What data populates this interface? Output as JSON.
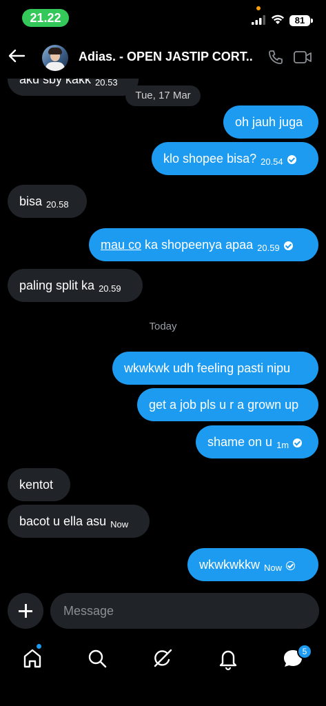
{
  "status_bar": {
    "time": "21.22",
    "battery": "81"
  },
  "header": {
    "title": "Adias. - OPEN JASTIP CORT..."
  },
  "messages": [
    {
      "dir": "in",
      "text": "aku sby kakk",
      "time": "20.53"
    },
    {
      "dir": "out",
      "text": "oh jauh juga"
    },
    {
      "dir": "out",
      "text": "klo shopee bisa?",
      "time": "20.54",
      "status": "read"
    },
    {
      "dir": "in",
      "text": "bisa",
      "time": "20.58"
    },
    {
      "dir": "out",
      "text_link": "mau co",
      "text": " ka shopeenya apaa",
      "time": "20.59",
      "status": "read"
    },
    {
      "dir": "in",
      "text": "paling split ka",
      "time": "20.59"
    },
    {
      "dir": "out",
      "text": "wkwkwk udh feeling pasti nipu"
    },
    {
      "dir": "out",
      "text": "get a job pls u r a grown up"
    },
    {
      "dir": "out",
      "text": "shame on u",
      "time": "1m",
      "status": "read"
    },
    {
      "dir": "in",
      "text": "kentot"
    },
    {
      "dir": "in",
      "text": "bacot u ella asu",
      "time": "Now"
    },
    {
      "dir": "out",
      "text": "wkwkwkkw",
      "time": "Now",
      "status": "sent"
    }
  ],
  "date_separators": {
    "first": "Tue, 17 Mar",
    "second": "Today"
  },
  "composer": {
    "placeholder": "Message"
  },
  "nav": {
    "messages_badge": "5"
  },
  "colors": {
    "accent": "#1d9bf0",
    "incoming_bubble": "#202327",
    "background": "#000000",
    "time_pill": "#34c759"
  }
}
